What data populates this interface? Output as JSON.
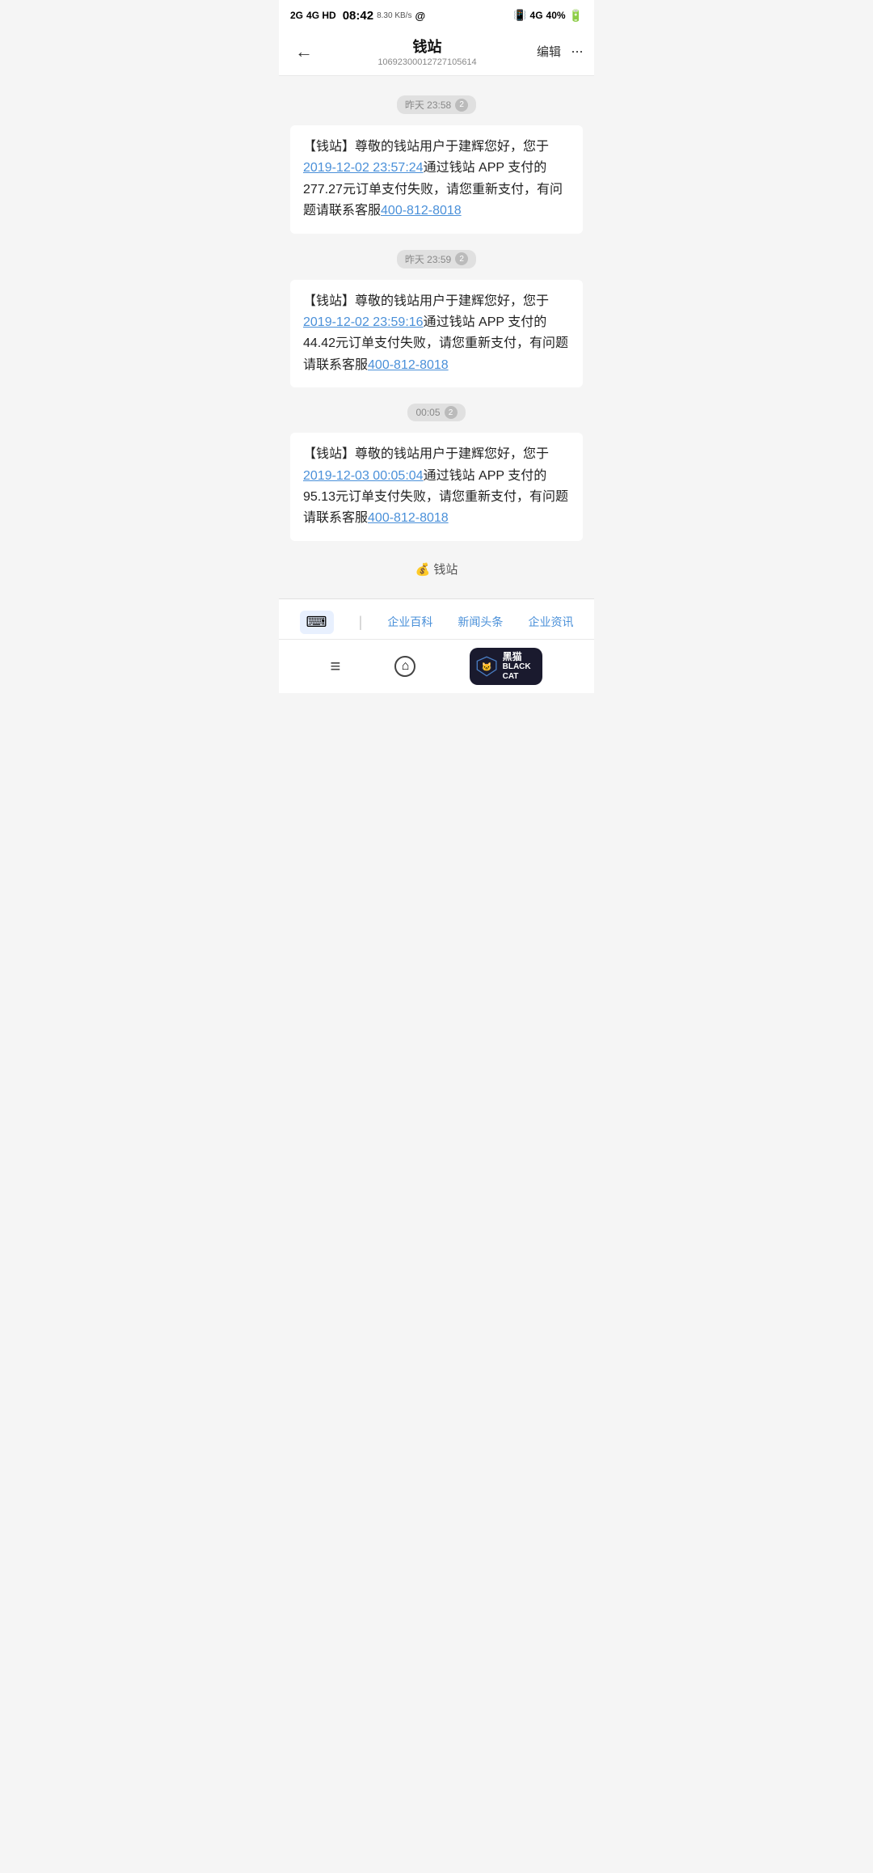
{
  "statusBar": {
    "carrier1": "2G",
    "carrier2": "4G HD",
    "time": "08:42",
    "speed": "8.30 KB/s",
    "icon": "@",
    "signal4g": "4G",
    "battery": "40%"
  },
  "navBar": {
    "backLabel": "←",
    "title": "钱站",
    "subtitle": "10692300012727105614",
    "editLabel": "编辑",
    "moreLabel": "···"
  },
  "messages": [
    {
      "timestamp": "昨天 23:58",
      "badgeCount": "2",
      "content": "【钱站】尊敬的钱站用户于建辉您好，您于",
      "linkText": "2019-12-02 23:57:24",
      "contentAfterLink": "通过钱站 APP 支付的277.27元订单支付失败，请您重新支付，有问题请联系客服",
      "phone": "400-812-8018"
    },
    {
      "timestamp": "昨天 23:59",
      "badgeCount": "2",
      "content": "【钱站】尊敬的钱站用户于建辉您好，您于",
      "linkText": "2019-12-02 23:59:16",
      "contentAfterLink": "通过钱站 APP 支付的44.42元订单支付失败，请您重新支付，有问题请联系客服",
      "phone": "400-812-8018"
    },
    {
      "timestamp": "00:05",
      "badgeCount": "2",
      "content": "【钱站】尊敬的钱站用户于建辉您好，您于",
      "linkText": "2019-12-03 00:05:04",
      "contentAfterLink": "通过钱站 APP 支付的95.13元订单支付失败，请您重新支付，有问题请联系客服",
      "phone": "400-812-8018"
    }
  ],
  "senderLabel": "💰 钱站",
  "bottomLinks": {
    "keyboardIcon": "⌨",
    "link1": "企业百科",
    "link2": "新闻头条",
    "link3": "企业资讯"
  },
  "homeBar": {
    "menuIcon": "≡",
    "homeIcon": "⌂"
  },
  "blackCat": {
    "line1": "黑猫",
    "line2": "BLACK CAT"
  }
}
